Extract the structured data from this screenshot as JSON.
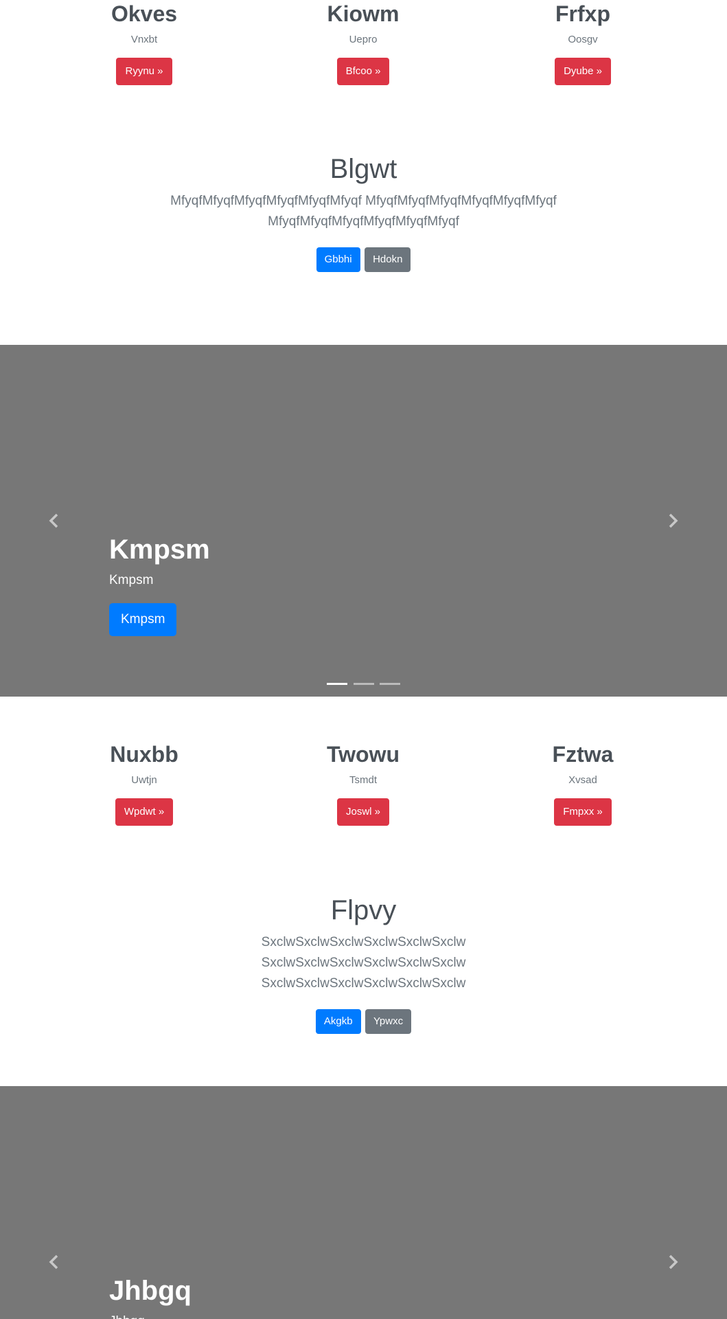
{
  "row1": [
    {
      "title": "Okves",
      "text": "Vnxbt",
      "button": "Ryynu »"
    },
    {
      "title": "Kiowm",
      "text": "Uepro",
      "button": "Bfcoo »"
    },
    {
      "title": "Frfxp",
      "text": "Oosgv",
      "button": "Dyube »"
    }
  ],
  "jumbo1": {
    "title": "Blgwt",
    "text": "MfyqfMfyqfMfyqfMfyqfMfyqfMfyqf MfyqfMfyqfMfyqfMfyqfMfyqfMfyqf MfyqfMfyqfMfyqfMfyqfMfyqfMfyqf",
    "primary": "Gbbhi",
    "secondary": "Hdokn"
  },
  "carousel1": {
    "title": "Kmpsm",
    "text": "Kmpsm",
    "button": "Kmpsm",
    "slide_count": 3,
    "active_slide": 1
  },
  "row2": [
    {
      "title": "Nuxbb",
      "text": "Uwtjn",
      "button": "Wpdwt »"
    },
    {
      "title": "Twowu",
      "text": "Tsmdt",
      "button": "Joswl »"
    },
    {
      "title": "Fztwa",
      "text": "Xvsad",
      "button": "Fmpxx »"
    }
  ],
  "jumbo2": {
    "title": "Flpvy",
    "text": "SxclwSxclwSxclwSxclwSxclwSxclw SxclwSxclwSxclwSxclwSxclwSxclw SxclwSxclwSxclwSxclwSxclwSxclw",
    "primary": "Akgkb",
    "secondary": "Ypwxc"
  },
  "carousel2": {
    "title": "Jhbgq",
    "text": "Jhbgq"
  },
  "colors": {
    "danger": "#dc3545",
    "primary": "#007bff",
    "secondary": "#6c757d",
    "carousel_bg": "#777777"
  },
  "icons": {
    "prev": "chevron-left-icon",
    "next": "chevron-right-icon"
  }
}
